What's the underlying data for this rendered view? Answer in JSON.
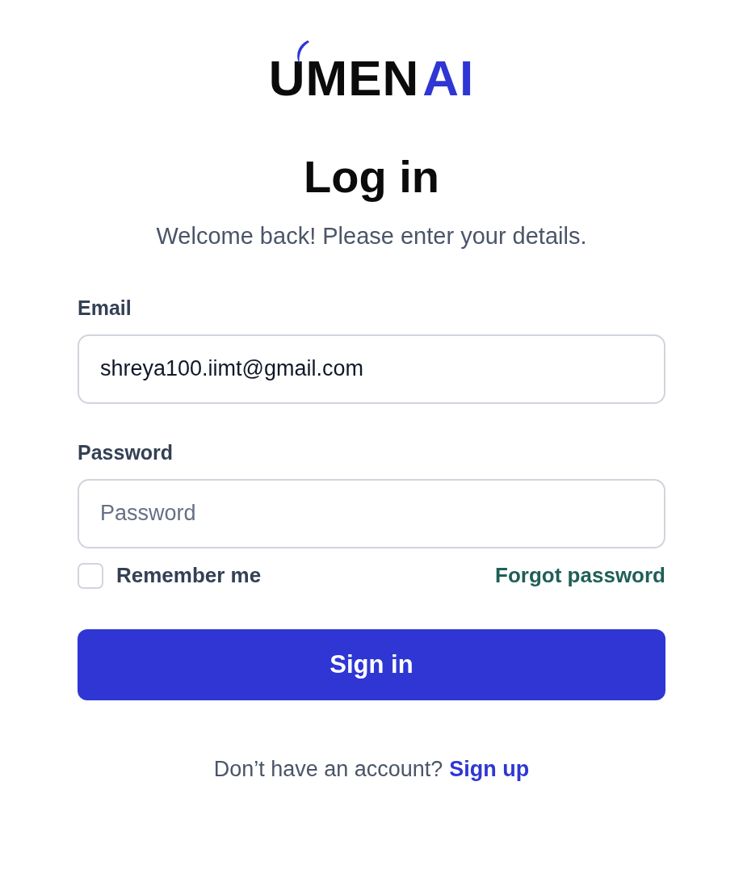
{
  "logo": {
    "dark": "UMEN",
    "accent": "AI"
  },
  "title": "Log in",
  "subtitle": "Welcome back! Please enter your details.",
  "fields": [
    {
      "label": "Email",
      "value": "shreya100.iimt@gmail.com"
    },
    {
      "label": "Password",
      "placeholder": "Password"
    }
  ],
  "remember": {
    "label": "Remember me",
    "checked": false
  },
  "forgot_link": "Forgot password",
  "submit": "Sign in",
  "footer": {
    "text": "Don’t have an account?",
    "link": "Sign up"
  }
}
